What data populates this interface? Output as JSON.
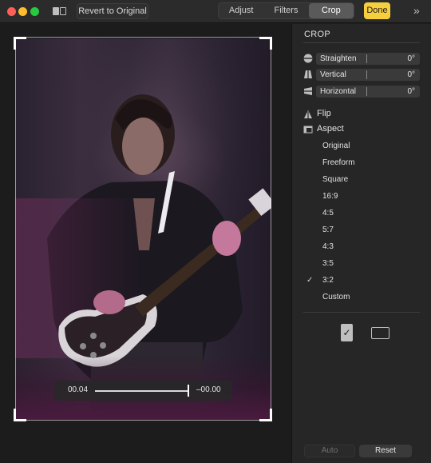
{
  "toolbar": {
    "revert_label": "Revert to Original",
    "tabs": [
      "Adjust",
      "Filters",
      "Crop"
    ],
    "active_tab": "Crop",
    "done_label": "Done",
    "more_icon": "»"
  },
  "canvas": {
    "straighten_left": "00.04",
    "straighten_right": "–00.00",
    "straighten_level": 0.98
  },
  "sidebar": {
    "title": "CROP",
    "sliders": [
      {
        "label": "Straighten",
        "value": "0°",
        "icon": "straighten-icon"
      },
      {
        "label": "Vertical",
        "value": "0°",
        "icon": "vertical-perspective-icon"
      },
      {
        "label": "Horizontal",
        "value": "0°",
        "icon": "horizontal-perspective-icon"
      }
    ],
    "flip_label": "Flip",
    "aspect_label": "Aspect",
    "aspects": [
      "Original",
      "Freeform",
      "Square",
      "16:9",
      "4:5",
      "5:7",
      "4:3",
      "3:5",
      "3:2",
      "Custom"
    ],
    "selected_aspect": "3:2",
    "check_glyph": "✓",
    "auto_label": "Auto",
    "reset_label": "Reset"
  },
  "colors": {
    "accent_done": "#f7ce3e",
    "sidebar_bg": "#262626",
    "toolbar_bg": "#2b2b2b"
  }
}
